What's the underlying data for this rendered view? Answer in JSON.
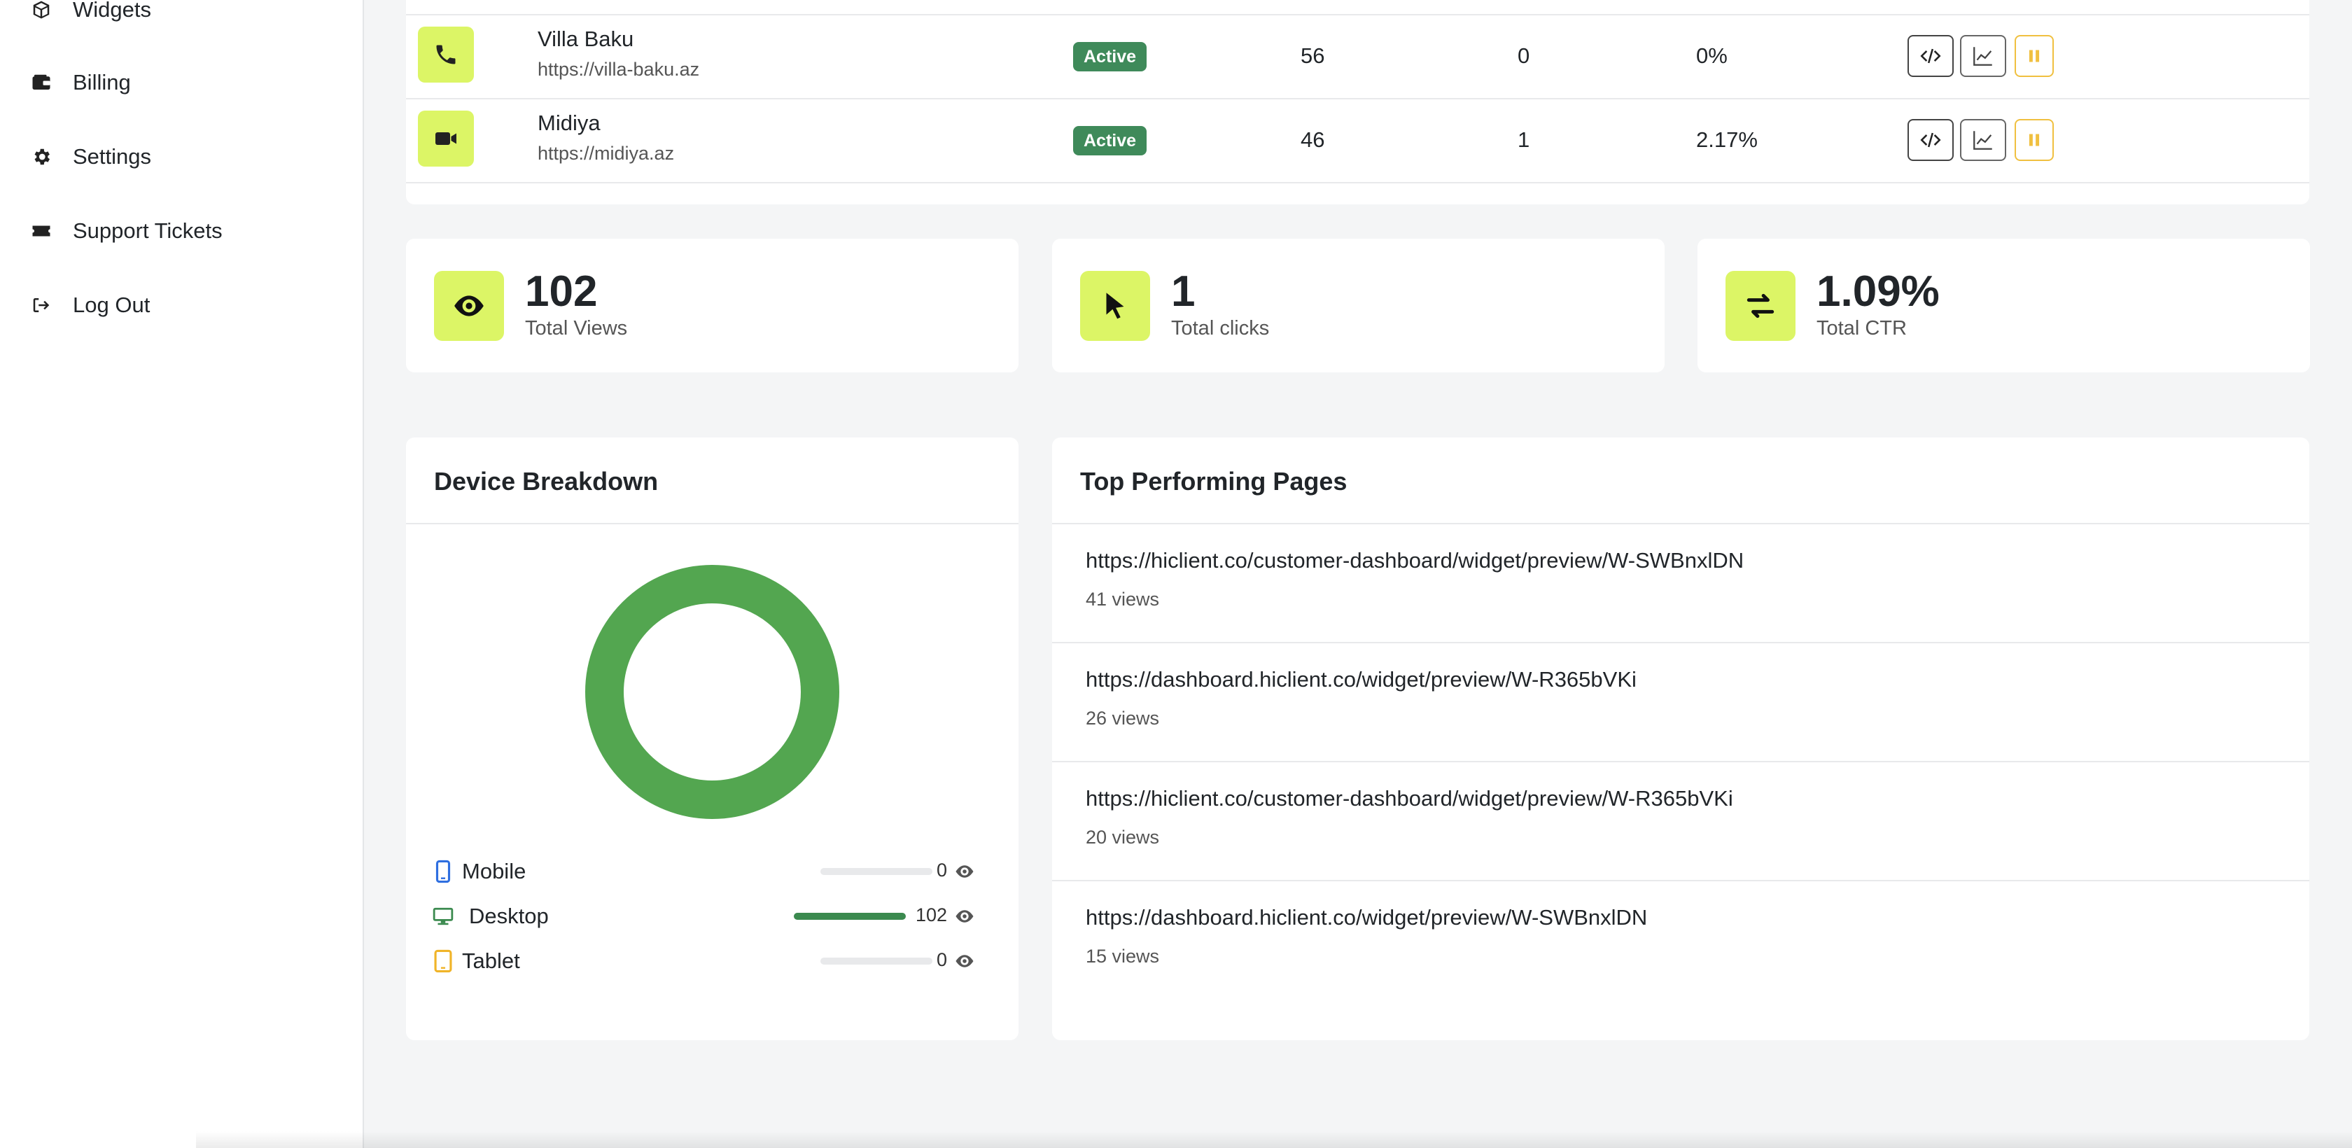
{
  "sidebar": {
    "items": [
      {
        "label": "Widgets",
        "icon": "box-icon"
      },
      {
        "label": "Billing",
        "icon": "wallet-icon"
      },
      {
        "label": "Settings",
        "icon": "gear-icon"
      },
      {
        "label": "Support Tickets",
        "icon": "ticket-icon"
      },
      {
        "label": "Log Out",
        "icon": "logout-icon"
      }
    ]
  },
  "widgets_table": {
    "rows": [
      {
        "name": "Villa Baku",
        "url": "https://villa-baku.az",
        "status": "Active",
        "views": "56",
        "clicks": "0",
        "ctr": "0%",
        "icon": "phone-icon"
      },
      {
        "name": "Midiya",
        "url": "https://midiya.az",
        "status": "Active",
        "views": "46",
        "clicks": "1",
        "ctr": "2.17%",
        "icon": "video-icon"
      }
    ]
  },
  "stats": [
    {
      "value": "102",
      "label": "Total Views",
      "icon": "eye-icon"
    },
    {
      "value": "1",
      "label": "Total clicks",
      "icon": "cursor-icon"
    },
    {
      "value": "1.09%",
      "label": "Total CTR",
      "icon": "exchange-icon"
    }
  ],
  "device_breakdown": {
    "title": "Device Breakdown",
    "devices": [
      {
        "label": "Mobile",
        "count": "0",
        "fraction": 0,
        "color": "#2f6fe0",
        "icon": "mobile-icon"
      },
      {
        "label": "Desktop",
        "count": "102",
        "fraction": 1,
        "color": "#3b8a4f",
        "icon": "desktop-icon"
      },
      {
        "label": "Tablet",
        "count": "0",
        "fraction": 0,
        "color": "#f0b429",
        "icon": "tablet-icon"
      }
    ],
    "donut_color": "#53a650"
  },
  "top_pages": {
    "title": "Top Performing Pages",
    "items": [
      {
        "url": "https://hiclient.co/customer-dashboard/widget/preview/W-SWBnxlDN",
        "views": "41 views"
      },
      {
        "url": "https://dashboard.hiclient.co/widget/preview/W-R365bVKi",
        "views": "26 views"
      },
      {
        "url": "https://hiclient.co/customer-dashboard/widget/preview/W-R365bVKi",
        "views": "20 views"
      },
      {
        "url": "https://dashboard.hiclient.co/widget/preview/W-SWBnxlDN",
        "views": "15 views"
      }
    ]
  },
  "colors": {
    "accent": "#dcf566",
    "active_badge": "#3f8a5a"
  }
}
